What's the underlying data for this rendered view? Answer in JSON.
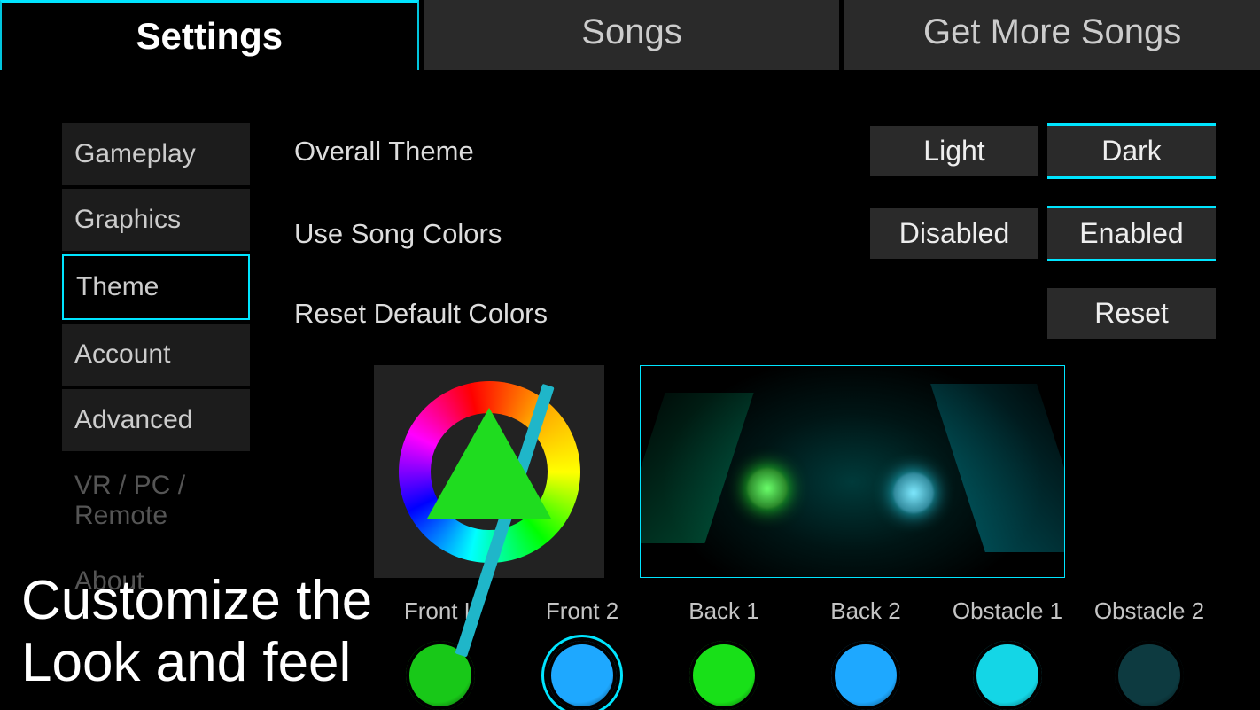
{
  "tabs": {
    "settings": "Settings",
    "songs": "Songs",
    "more": "Get More Songs"
  },
  "sidebar": [
    {
      "label": "Gameplay"
    },
    {
      "label": "Graphics"
    },
    {
      "label": "Theme"
    },
    {
      "label": "Account"
    },
    {
      "label": "Advanced"
    },
    {
      "label": "VR / PC / Remote"
    },
    {
      "label": "About"
    }
  ],
  "settings": {
    "overallTheme": {
      "label": "Overall Theme",
      "light": "Light",
      "dark": "Dark",
      "selected": "Dark"
    },
    "useSongColors": {
      "label": "Use Song Colors",
      "disabled": "Disabled",
      "enabled": "Enabled",
      "selected": "Enabled"
    },
    "resetColors": {
      "label": "Reset Default Colors",
      "button": "Reset"
    }
  },
  "colorSlots": [
    {
      "label": "Front L",
      "color": "#18c818"
    },
    {
      "label": "Front 2",
      "color": "#1ea8ff",
      "selected": true
    },
    {
      "label": "Back 1",
      "color": "#18e018"
    },
    {
      "label": "Back 2",
      "color": "#1ea8ff"
    },
    {
      "label": "Obstacle 1",
      "color": "#14d6e6"
    },
    {
      "label": "Obstacle 2",
      "color": "#0d3a40"
    }
  ],
  "caption": {
    "line1": "Customize the",
    "line2": "Look and feel"
  }
}
